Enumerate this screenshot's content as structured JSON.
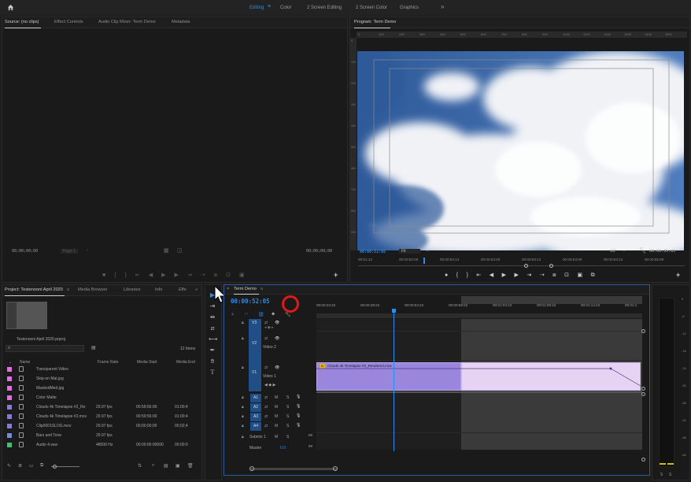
{
  "workspaces": {
    "tabs": [
      {
        "label": "Editing",
        "active": true
      },
      {
        "label": "Color"
      },
      {
        "label": "2 Screen Editing"
      },
      {
        "label": "2 Screen Color"
      },
      {
        "label": "Graphics"
      }
    ],
    "more": "»"
  },
  "source_panel": {
    "tabs": [
      "Source: (no clips)",
      "Effect Controls",
      "Audio Clip Mixer: Term Demo",
      "Metadata"
    ],
    "tc_left": "00;00;00;00",
    "page_label": "Page 1",
    "tc_right": "00;00;00;00"
  },
  "program_panel": {
    "title": "Program: Term Demo",
    "ruler": [
      "0",
      "100",
      "200",
      "300",
      "400",
      "500",
      "600",
      "700",
      "800",
      "900",
      "1000",
      "1100",
      "1200",
      "1300",
      "1400",
      "1500"
    ],
    "tc_current": "00:00:52:05",
    "fit_label": "Fit",
    "resolution": "1/2",
    "tc_duration": "00:00:35:03",
    "timecodes": [
      "00:51:12",
      "00:00:52:00",
      "00:00:52:12",
      "00:00:53:00",
      "00:00:53:12",
      "00:00:54:00",
      "00:00:54:12",
      "00:00:55:00"
    ]
  },
  "project_panel": {
    "tabs": [
      "Project: Testenooni April 2020",
      "Media Browser",
      "Libraries",
      "Info",
      "Effe"
    ],
    "project_file": "Testenooni April 2020.prproj",
    "items_count": "12 Items",
    "columns": [
      "Name",
      "Frame Rate",
      "Media Start",
      "Media End"
    ],
    "rows": [
      {
        "name": "Transparent Video",
        "frame_rate": "",
        "media_start": "",
        "media_end": "",
        "color": "#e070e0"
      },
      {
        "name": "Skip-on Mat.jpg",
        "frame_rate": "",
        "media_start": "",
        "media_end": "",
        "color": "#e070e0"
      },
      {
        "name": "MaskedMed.jpg",
        "frame_rate": "",
        "media_start": "",
        "media_end": "",
        "color": "#e070e0"
      },
      {
        "name": "Color Matte",
        "frame_rate": "",
        "media_start": "",
        "media_end": "",
        "color": "#e070e0"
      },
      {
        "name": "Clouds 4k Timelapse #2_Re",
        "frame_rate": "29.97 fps",
        "media_start": "00:59:56:00",
        "media_end": "01:00:4",
        "color": "#8a7ad8"
      },
      {
        "name": "Clouds 4k Timelapse #2.mov",
        "frame_rate": "29.97 fps",
        "media_start": "00:59:56:00",
        "media_end": "01:00:4",
        "color": "#8a7ad8"
      },
      {
        "name": "Clip0001SLOG.mov",
        "frame_rate": "29.97 fps",
        "media_start": "00;00;00;00",
        "media_end": "00;02;4",
        "color": "#8a7ad8"
      },
      {
        "name": "Bars and Tone",
        "frame_rate": "29.97 fps",
        "media_start": "",
        "media_end": "",
        "color": "#7a8ad8"
      },
      {
        "name": "Audio 4.wav",
        "frame_rate": "48000 Hz",
        "media_start": "00:00:00:00000",
        "media_end": "00:00:0",
        "color": "#40c070"
      }
    ]
  },
  "timeline": {
    "sequence_tab": "Term Demo",
    "tc_current": "00:00:52:05",
    "ruler": [
      "00:00:44:22",
      "00:00:49:22",
      "00:00:54:22",
      "00:00:59:22",
      "00:01:04:22",
      "00:01:09:22",
      "00:01:14:22",
      "00:01:1"
    ],
    "tracks_video": [
      {
        "patch": "V3",
        "name": ""
      },
      {
        "patch": "V2",
        "name": "Video 2"
      },
      {
        "patch": "V1",
        "name": "Video 1"
      }
    ],
    "tracks_audio": [
      "A1",
      "A2",
      "A3",
      "A4"
    ],
    "submix": "Submix 1",
    "master": "Master",
    "master_value": "0.0",
    "clip_name": "Clouds 4k Timelapse #2_Rendered.mov",
    "clip_badge": "fx"
  },
  "audio_meter": {
    "labels": [
      "0",
      "-6",
      "-12",
      "-18",
      "-24",
      "-30",
      "-36",
      "-42",
      "-48",
      "-54"
    ],
    "solo_labels": [
      "S",
      "S"
    ]
  }
}
